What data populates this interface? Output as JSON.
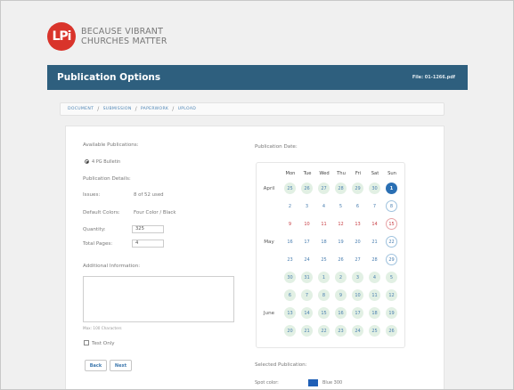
{
  "brand": {
    "logo_mark": "LPi",
    "tagline_line1": "BECAUSE VIBRANT",
    "tagline_line2": "CHURCHES MATTER",
    "accent_color": "#d9342b"
  },
  "titlebar": {
    "title": "Publication Options",
    "file": "File: 01-1266.pdf",
    "color": "#2e5f7e"
  },
  "breadcrumb": [
    "Document",
    "Submission",
    "Paperwork",
    "Upload"
  ],
  "left": {
    "available_label": "Available Publications:",
    "publication_option": "4 PG Bulletin",
    "details_heading": "Publication Details:",
    "issues_label": "Issues:",
    "issues_value": "8 of 52 used",
    "colors_label": "Default Colors:",
    "colors_value": "Four Color / Black",
    "quantity_label": "Quantity:",
    "quantity_value": "325",
    "pages_label": "Total Pages:",
    "pages_value": "4",
    "additional_label": "Additional Information:",
    "max_chars": "Max: 100 Characters",
    "test_only": "Test Only",
    "back_label": "Back",
    "next_label": "Next"
  },
  "right": {
    "dates_label": "Publication Date:",
    "selected_label": "Selected Publication:",
    "spot_label": "Spot color:",
    "spot_value": "Blue 300",
    "spot_color": "#1f5fb6"
  },
  "calendar": {
    "weekdays": [
      "Mon",
      "Tue",
      "Wed",
      "Thu",
      "Fri",
      "Sat",
      "Sun"
    ],
    "months": [
      {
        "name": "April",
        "row": 0
      },
      {
        "name": "May",
        "row": 3
      },
      {
        "name": "June",
        "row": 7
      }
    ],
    "rows": [
      [
        {
          "d": "25",
          "s": "avail"
        },
        {
          "d": "26",
          "s": "avail"
        },
        {
          "d": "27",
          "s": "avail"
        },
        {
          "d": "28",
          "s": "avail"
        },
        {
          "d": "29",
          "s": "avail"
        },
        {
          "d": "30",
          "s": "avail"
        },
        {
          "d": "1",
          "s": "sel"
        }
      ],
      [
        {
          "d": "2",
          "s": "past"
        },
        {
          "d": "3",
          "s": "past"
        },
        {
          "d": "4",
          "s": "past"
        },
        {
          "d": "5",
          "s": "past"
        },
        {
          "d": "6",
          "s": "past"
        },
        {
          "d": "7",
          "s": "past"
        },
        {
          "d": "8",
          "s": "ring"
        }
      ],
      [
        {
          "d": "9",
          "s": "blocked"
        },
        {
          "d": "10",
          "s": "blocked"
        },
        {
          "d": "11",
          "s": "blocked"
        },
        {
          "d": "12",
          "s": "blocked"
        },
        {
          "d": "13",
          "s": "blocked"
        },
        {
          "d": "14",
          "s": "blocked"
        },
        {
          "d": "15",
          "s": "blocked-ring"
        }
      ],
      [
        {
          "d": "16",
          "s": "past"
        },
        {
          "d": "17",
          "s": "past"
        },
        {
          "d": "18",
          "s": "past"
        },
        {
          "d": "19",
          "s": "past"
        },
        {
          "d": "20",
          "s": "past"
        },
        {
          "d": "21",
          "s": "past"
        },
        {
          "d": "22",
          "s": "ring"
        }
      ],
      [
        {
          "d": "23",
          "s": "past"
        },
        {
          "d": "24",
          "s": "past"
        },
        {
          "d": "25",
          "s": "past"
        },
        {
          "d": "26",
          "s": "past"
        },
        {
          "d": "27",
          "s": "past"
        },
        {
          "d": "28",
          "s": "past"
        },
        {
          "d": "29",
          "s": "ring"
        }
      ],
      [
        {
          "d": "30",
          "s": "avail"
        },
        {
          "d": "31",
          "s": "avail"
        },
        {
          "d": "1",
          "s": "avail"
        },
        {
          "d": "2",
          "s": "avail"
        },
        {
          "d": "3",
          "s": "avail"
        },
        {
          "d": "4",
          "s": "avail"
        },
        {
          "d": "5",
          "s": "avail"
        }
      ],
      [
        {
          "d": "6",
          "s": "avail"
        },
        {
          "d": "7",
          "s": "avail"
        },
        {
          "d": "8",
          "s": "avail"
        },
        {
          "d": "9",
          "s": "avail"
        },
        {
          "d": "10",
          "s": "avail"
        },
        {
          "d": "11",
          "s": "avail"
        },
        {
          "d": "12",
          "s": "avail"
        }
      ],
      [
        {
          "d": "13",
          "s": "avail"
        },
        {
          "d": "14",
          "s": "avail"
        },
        {
          "d": "15",
          "s": "avail"
        },
        {
          "d": "16",
          "s": "avail"
        },
        {
          "d": "17",
          "s": "avail"
        },
        {
          "d": "18",
          "s": "avail"
        },
        {
          "d": "19",
          "s": "avail"
        }
      ],
      [
        {
          "d": "20",
          "s": "avail"
        },
        {
          "d": "21",
          "s": "avail"
        },
        {
          "d": "22",
          "s": "avail"
        },
        {
          "d": "23",
          "s": "avail"
        },
        {
          "d": "24",
          "s": "avail"
        },
        {
          "d": "25",
          "s": "avail"
        },
        {
          "d": "26",
          "s": "avail"
        }
      ]
    ]
  }
}
